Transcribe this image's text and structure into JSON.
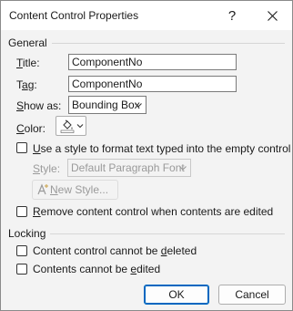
{
  "dialog": {
    "title": "Content Control Properties",
    "help_icon": "?",
    "close_icon": "×"
  },
  "general": {
    "section_label": "General",
    "title": {
      "label_first": "T",
      "label_rest": "itle:",
      "value": "ComponentNo"
    },
    "tag": {
      "label_first": "T",
      "label_under": "a",
      "label_rest": "g:",
      "value": "ComponentNo"
    },
    "show_as": {
      "label_first": "S",
      "label_rest": "how as:",
      "value": "Bounding Box"
    },
    "color": {
      "label_first": "C",
      "label_rest": "olor:",
      "icon": "fill-bucket-icon"
    },
    "use_style": {
      "label_under": "U",
      "label_rest": "se a style to format text typed into the empty control",
      "checked": false
    },
    "style": {
      "label_first": "S",
      "label_rest": "tyle:",
      "value": "Default Paragraph Font"
    },
    "new_style": {
      "label_prefix": "A",
      "label_under": "N",
      "label_rest": "ew Style..."
    },
    "remove": {
      "label_under": "R",
      "label_rest": "emove content control when contents are edited",
      "checked": false
    }
  },
  "locking": {
    "section_label": "Locking",
    "cannot_delete": {
      "label_pre": "Content control cannot be ",
      "label_under": "d",
      "label_rest": "eleted",
      "checked": false
    },
    "cannot_edit": {
      "label_pre": "Contents cannot be ",
      "label_under": "e",
      "label_rest": "dited",
      "checked": false
    }
  },
  "buttons": {
    "ok": "OK",
    "cancel": "Cancel"
  },
  "colors": {
    "accent": "#0067c0",
    "background": "#f3f3f3",
    "disabled_text": "#9a9a9a"
  }
}
